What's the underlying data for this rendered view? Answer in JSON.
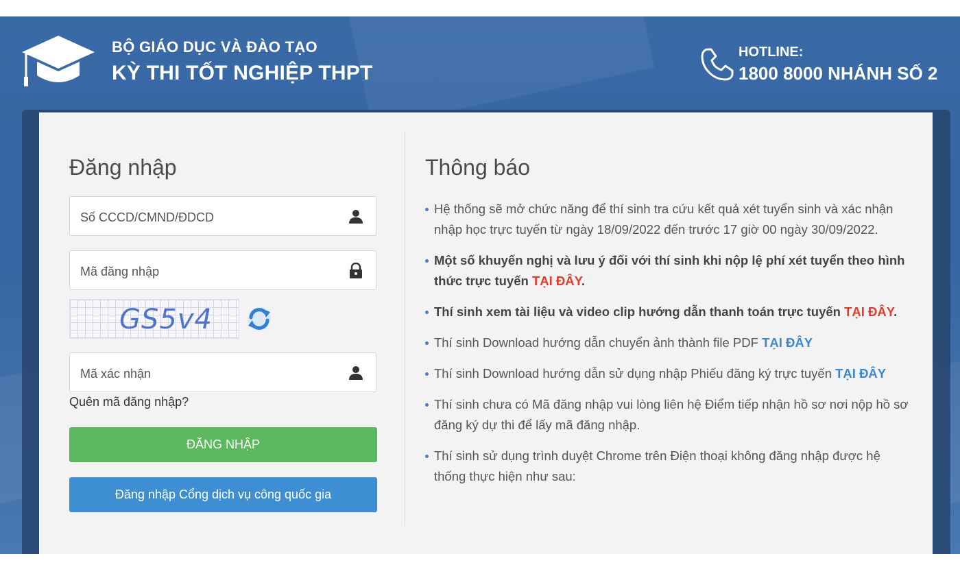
{
  "header": {
    "ministry": "BỘ GIÁO DỤC VÀ ĐÀO TẠO",
    "exam_title": "KỲ THI TỐT NGHIỆP THPT",
    "hotline_label": "HOTLINE:",
    "hotline_number": "1800 8000 NHÁNH SỐ 2",
    "logo_icon": "graduation-cap-icon",
    "phone_icon": "phone-icon"
  },
  "login": {
    "title": "Đăng nhập",
    "id_placeholder": "Số CCCD/CMND/ĐDCD",
    "password_placeholder": "Mã đăng nhập",
    "captcha_text": "GS5v4",
    "captcha_code_placeholder": "Mã xác nhận",
    "forgot_link": "Quên mã đăng nhập?",
    "login_button": "ĐĂNG NHẬP",
    "portal_button": "Đăng nhập Cổng dịch vụ công quốc gia"
  },
  "news": {
    "title": "Thông báo",
    "items": [
      {
        "text": "Hệ thống sẽ mở chức năng để thí sinh tra cứu kết quả xét tuyển sinh và xác nhận nhập học trực tuyến từ ngày 18/09/2022 đến trước 17 giờ 00 ngày 30/09/2022.",
        "link": ""
      },
      {
        "text": "Một số khuyến nghị và lưu ý đối với thí sinh khi nộp lệ phí xét tuyển theo hình thức trực tuyến ",
        "link": "TẠI ĐÂY",
        "suffix": "."
      },
      {
        "text": "Thí sinh xem tài liệu và video clip hướng dẫn thanh toán trực tuyến ",
        "link": "TẠI ĐÂY",
        "suffix": "."
      },
      {
        "text": "Thí sinh Download hướng dẫn chuyển ảnh thành file PDF ",
        "link": "TẠI ĐÂY"
      },
      {
        "text": "Thí sinh Download hướng dẫn sử dụng nhập Phiếu đăng ký trực tuyến ",
        "link": "TẠI ĐÂY"
      },
      {
        "text": "Thí sinh chưa có Mã đăng nhập vui lòng liên hệ Điểm tiếp nhận hồ sơ nơi nộp hồ sơ đăng ký dự thi để lấy mã đăng nhập.",
        "link": ""
      },
      {
        "text": "Thí sinh sử dụng trình duyệt Chrome trên Điện thoại không đăng nhập được hệ thống thực hiện như sau:",
        "link": ""
      }
    ]
  },
  "colors": {
    "banner": "#3565a2",
    "login_button": "#5cb85c",
    "portal_button": "#3d8ed3",
    "link_red": "#e23a2c",
    "link_blue": "#3b86d0"
  }
}
